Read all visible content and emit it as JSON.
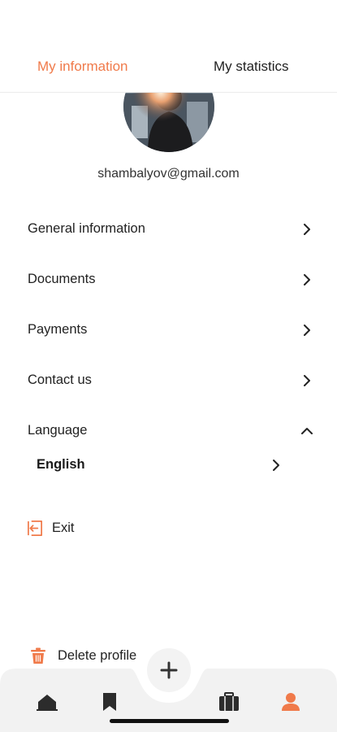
{
  "tabs": {
    "info_label": "My information",
    "stats_label": "My statistics"
  },
  "profile": {
    "email": "shambalyov@gmail.com"
  },
  "menu": {
    "items": [
      {
        "label": "General information"
      },
      {
        "label": "Documents"
      },
      {
        "label": "Payments"
      },
      {
        "label": "Contact us"
      }
    ],
    "language_label": "Language",
    "language_value": "English",
    "exit_label": "Exit",
    "delete_label": "Delete profile"
  },
  "nav": {
    "items": [
      "home-icon",
      "bookmark-icon",
      "add-icon",
      "briefcase-icon",
      "profile-icon"
    ],
    "active": "profile-icon"
  },
  "colors": {
    "accent": "#f07a4a",
    "text": "#1f1f1f",
    "nav_bg": "#f2f2f2"
  }
}
